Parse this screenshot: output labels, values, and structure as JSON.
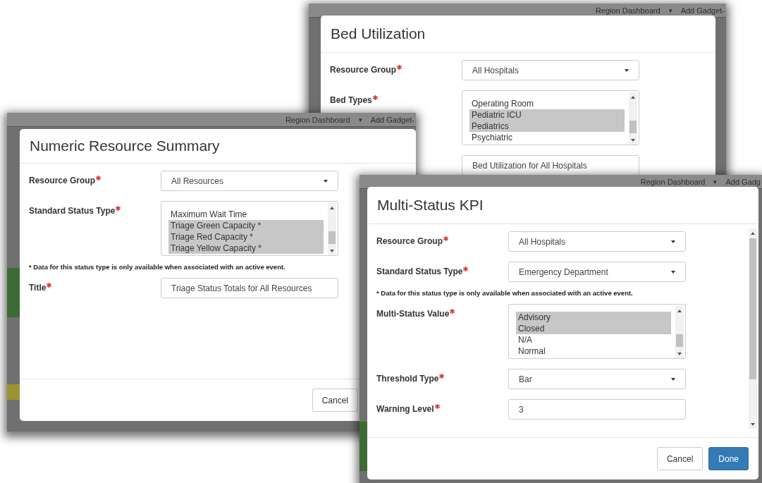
{
  "windows": [
    {
      "backdrop": {
        "menu": "Region Dashboard",
        "caret": "▾",
        "add_button": "Add Gadget-"
      },
      "dialog": {
        "title": "Bed Utilization",
        "fields": [
          {
            "kind": "select",
            "label": "Resource Group",
            "required": true,
            "value": "All Hospitals"
          },
          {
            "kind": "listbox",
            "label": "Bed Types",
            "required": true,
            "options": [
              {
                "label": "Operating Room",
                "selected": false
              },
              {
                "label": "Pediatric ICU",
                "selected": true
              },
              {
                "label": "Pediatrics",
                "selected": true
              },
              {
                "label": "Psychiatric",
                "selected": false
              }
            ]
          },
          {
            "kind": "text",
            "value": "Bed Utilization for All Hospitals"
          }
        ]
      }
    },
    {
      "backdrop": {
        "menu": "Region Dashboard",
        "caret": "▾",
        "add_button": "Add Gadget-"
      },
      "dialog": {
        "title": "Numeric Resource Summary",
        "fields": [
          {
            "kind": "select",
            "label": "Resource Group",
            "required": true,
            "value": "All Resources"
          },
          {
            "kind": "listbox",
            "label": "Standard Status Type",
            "required": true,
            "options": [
              {
                "label": "Maximum Wait Time",
                "selected": false
              },
              {
                "label": "Triage Green Capacity *",
                "selected": true
              },
              {
                "label": "Triage Red Capacity *",
                "selected": true
              },
              {
                "label": "Triage Yellow Capacity *",
                "selected": true
              }
            ]
          },
          {
            "kind": "note",
            "text": "* Data for this status type is only available when associated with an active event."
          },
          {
            "kind": "text",
            "label": "Title",
            "required": true,
            "value": "Triage Status Totals for All Resources"
          }
        ],
        "buttons": [
          {
            "label": "Cancel",
            "kind": "default"
          }
        ]
      }
    },
    {
      "backdrop": {
        "menu": "Region Dashboard",
        "caret": "▾",
        "add_button": "Add Gadg"
      },
      "dialog": {
        "title": "Multi-Status KPI",
        "fields": [
          {
            "kind": "select",
            "label": "Resource Group",
            "required": true,
            "value": "All Hospitals"
          },
          {
            "kind": "select",
            "label": "Standard Status Type",
            "required": true,
            "value": "Emergency Department"
          },
          {
            "kind": "note",
            "text": "* Data for this status type is only available when associated with an active event."
          },
          {
            "kind": "listbox",
            "label": "Multi-Status Value",
            "required": true,
            "options": [
              {
                "label": "Advisory",
                "selected": true
              },
              {
                "label": "Closed",
                "selected": true
              },
              {
                "label": "N/A",
                "selected": false
              },
              {
                "label": "Normal",
                "selected": false
              }
            ]
          },
          {
            "kind": "select",
            "label": "Threshold Type",
            "required": true,
            "value": "Bar"
          },
          {
            "kind": "text",
            "label": "Warning Level",
            "required": true,
            "value": "3"
          }
        ],
        "buttons": [
          {
            "label": "Cancel",
            "kind": "default"
          },
          {
            "label": "Done",
            "kind": "primary"
          }
        ]
      }
    }
  ]
}
